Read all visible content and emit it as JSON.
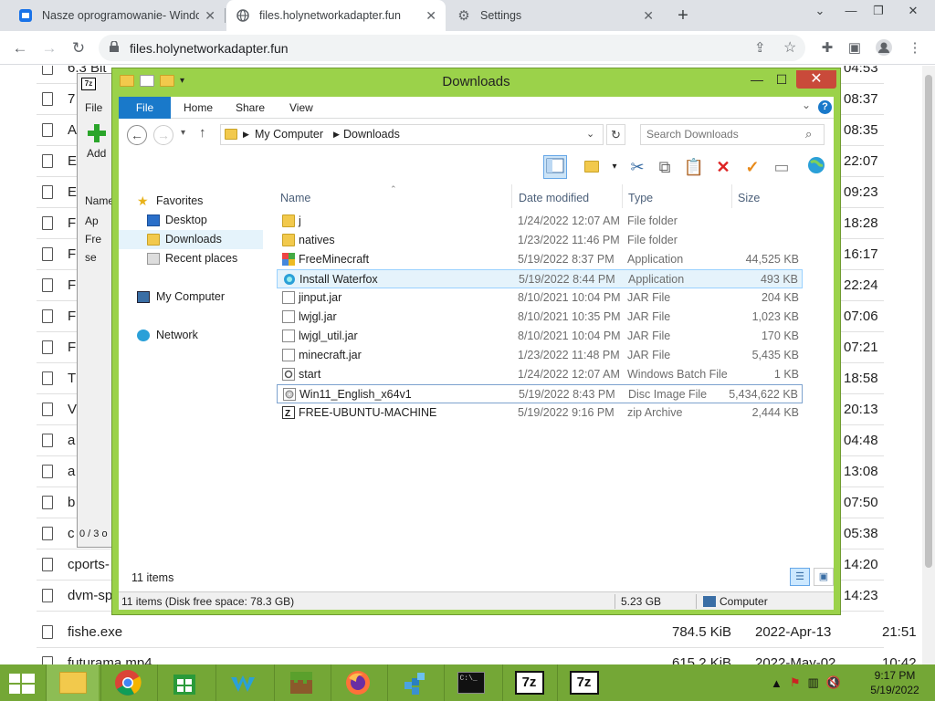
{
  "browser": {
    "tabs": [
      {
        "label": "Nasze oprogramowanie- Windo",
        "icon": "app-icon"
      },
      {
        "label": "files.holynetworkadapter.fun",
        "icon": "globe-icon"
      },
      {
        "label": "Settings",
        "icon": "gear-icon"
      }
    ],
    "url": "files.holynetworkadapter.fun"
  },
  "page": {
    "rows": [
      {
        "name": "6.3 Bit ...",
        "size": "",
        "date": "",
        "time": "04:53"
      },
      {
        "name": "7",
        "size": "",
        "date": "",
        "time": "08:37"
      },
      {
        "name": "A",
        "size": "",
        "date": "",
        "time": "08:35"
      },
      {
        "name": "E",
        "size": "",
        "date": "",
        "time": "22:07"
      },
      {
        "name": "E",
        "size": "",
        "date": "",
        "time": "09:23"
      },
      {
        "name": "F",
        "size": "",
        "date": "",
        "time": "18:28"
      },
      {
        "name": "F",
        "size": "",
        "date": "",
        "time": "16:17"
      },
      {
        "name": "F",
        "size": "",
        "date": "",
        "time": "22:24"
      },
      {
        "name": "F",
        "size": "",
        "date": "",
        "time": "07:06"
      },
      {
        "name": "F",
        "size": "",
        "date": "",
        "time": "07:21"
      },
      {
        "name": "T",
        "size": "",
        "date": "",
        "time": "18:58"
      },
      {
        "name": "V",
        "size": "",
        "date": "",
        "time": "20:13"
      },
      {
        "name": "a",
        "size": "",
        "date": "",
        "time": "04:48"
      },
      {
        "name": "a",
        "size": "",
        "date": "",
        "time": "13:08"
      },
      {
        "name": "b",
        "size": "",
        "date": "",
        "time": "07:50"
      },
      {
        "name": "c",
        "size": "",
        "date": "",
        "time": "05:38"
      },
      {
        "name": "cports-",
        "size": "",
        "date": "",
        "time": "14:20"
      },
      {
        "name": "dvm-sp",
        "size": "",
        "date": "",
        "time": "14:23"
      },
      {
        "name": "fishe.exe",
        "size": "784.5 KiB",
        "date": "2022-Apr-13",
        "time": "21:51"
      },
      {
        "name": "futurama.mp4",
        "size": "615.2 KiB",
        "date": "2022-May-02",
        "time": "10:42"
      }
    ]
  },
  "sevenzip": {
    "logo": "7z",
    "menu_file": "File",
    "add_label": "Add",
    "name_header": "Name",
    "rows": [
      "Ap",
      "Fre",
      "se"
    ],
    "status": "0 / 3 o"
  },
  "explorer": {
    "title": "Downloads",
    "ribbon_tabs": [
      "File",
      "Home",
      "Share",
      "View"
    ],
    "help": "?",
    "breadcrumb": [
      "My Computer",
      "Downloads"
    ],
    "search_placeholder": "Search Downloads",
    "nav": {
      "favorites": "Favorites",
      "desktop": "Desktop",
      "downloads": "Downloads",
      "recent": "Recent places",
      "computer": "My Computer",
      "network": "Network"
    },
    "columns": [
      "Name",
      "Date modified",
      "Type",
      "Size"
    ],
    "files": [
      {
        "name": "j",
        "date": "1/24/2022 12:07 AM",
        "type": "File folder",
        "size": "",
        "icon": "folder-icon"
      },
      {
        "name": "natives",
        "date": "1/23/2022 11:46 PM",
        "type": "File folder",
        "size": "",
        "icon": "folder-icon"
      },
      {
        "name": "FreeMinecraft",
        "date": "5/19/2022 8:37 PM",
        "type": "Application",
        "size": "44,525 KB",
        "icon": "app-icon"
      },
      {
        "name": "Install Waterfox",
        "date": "5/19/2022 8:44 PM",
        "type": "Application",
        "size": "493 KB",
        "icon": "waterfox-icon"
      },
      {
        "name": "jinput.jar",
        "date": "8/10/2021 10:04 PM",
        "type": "JAR File",
        "size": "204 KB",
        "icon": "file-icon"
      },
      {
        "name": "lwjgl.jar",
        "date": "8/10/2021 10:35 PM",
        "type": "JAR File",
        "size": "1,023 KB",
        "icon": "file-icon"
      },
      {
        "name": "lwjgl_util.jar",
        "date": "8/10/2021 10:04 PM",
        "type": "JAR File",
        "size": "170 KB",
        "icon": "file-icon"
      },
      {
        "name": "minecraft.jar",
        "date": "1/23/2022 11:48 PM",
        "type": "JAR File",
        "size": "5,435 KB",
        "icon": "file-icon"
      },
      {
        "name": "start",
        "date": "1/24/2022 12:07 AM",
        "type": "Windows Batch File",
        "size": "1 KB",
        "icon": "gear-file-icon"
      },
      {
        "name": "Win11_English_x64v1",
        "date": "5/19/2022 8:43 PM",
        "type": "Disc Image File",
        "size": "5,434,622 KB",
        "icon": "disc-icon"
      },
      {
        "name": "FREE-UBUNTU-MACHINE",
        "date": "5/19/2022 9:16 PM",
        "type": "zip Archive",
        "size": "2,444 KB",
        "icon": "zip-icon"
      }
    ],
    "item_count": "11 items",
    "status_left": "11 items (Disk free space: 78.3 GB)",
    "status_mid": "5.23 GB",
    "status_right": "Computer"
  },
  "taskbar": {
    "clock_time": "9:17 PM",
    "clock_date": "5/19/2022",
    "sevenzip_label_1": "7z",
    "sevenzip_label_2": "7z",
    "cmd_label": "C:\\_"
  },
  "colors": {
    "explorer_frame": "#9bd24a",
    "taskbar": "#74a736",
    "ribbon_file": "#1979ca",
    "close_button": "#c94a3a"
  }
}
